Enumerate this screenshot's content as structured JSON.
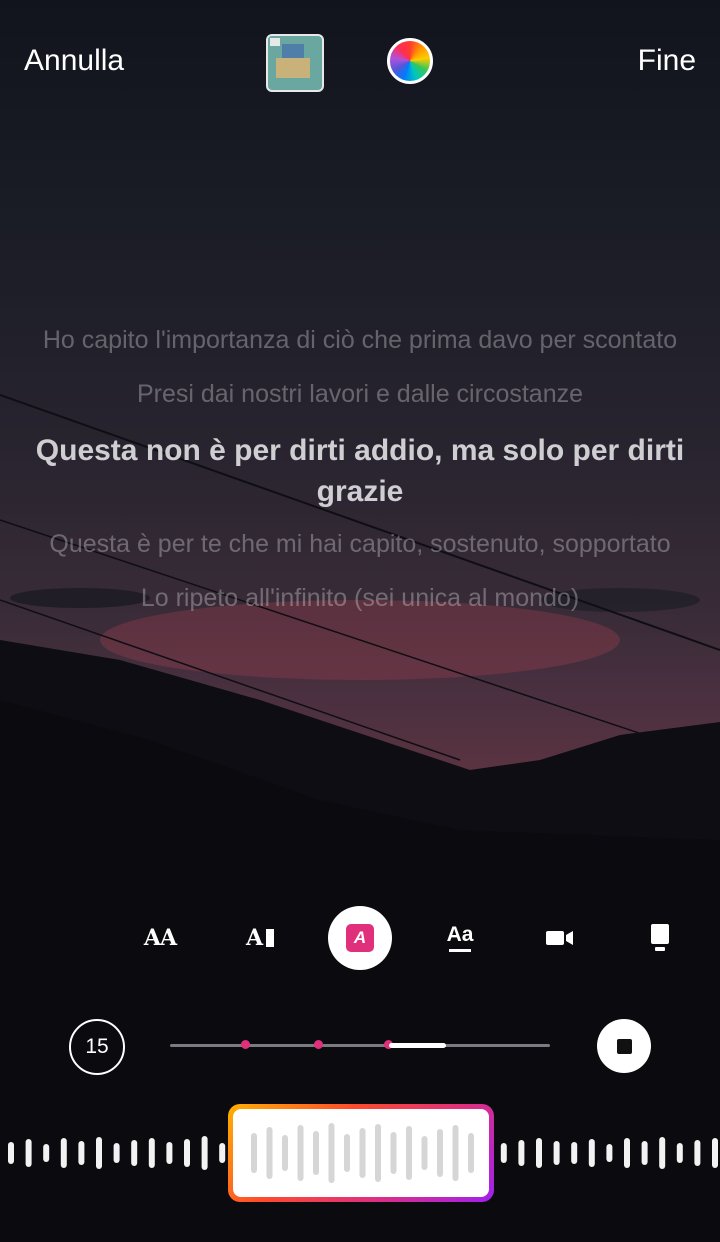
{
  "top_bar": {
    "cancel_label": "Annulla",
    "done_label": "Fine"
  },
  "lyrics": {
    "lines": [
      "Ho capito l'importanza di ciò che prima davo per scontato",
      "Presi dai nostri lavori e dalle circostanze",
      "Questa non è per dirti addio, ma solo per dirti grazie",
      "Questa è per te che mi hai capito, sostenuto, sopportato",
      "Lo ripeto all'infinito (sei unica al mondo)"
    ],
    "active_index": 2
  },
  "tools": {
    "items": [
      "text-size-icon",
      "text-cursor-icon",
      "highlight-style-icon",
      "underline-style-icon",
      "camera-style-icon",
      "card-style-icon"
    ],
    "selected": "highlight-style-icon",
    "highlight_letter": "A",
    "size_label": "AA",
    "cursor_label": "A",
    "underline_label": "Aa"
  },
  "playback": {
    "duration_label": "15",
    "progress": 0.07,
    "accent_color": "#e0307c"
  },
  "waveform": {
    "selection_gradient": [
      "#ffb200",
      "#ff4b2b",
      "#e0307c",
      "#a020f0"
    ]
  }
}
